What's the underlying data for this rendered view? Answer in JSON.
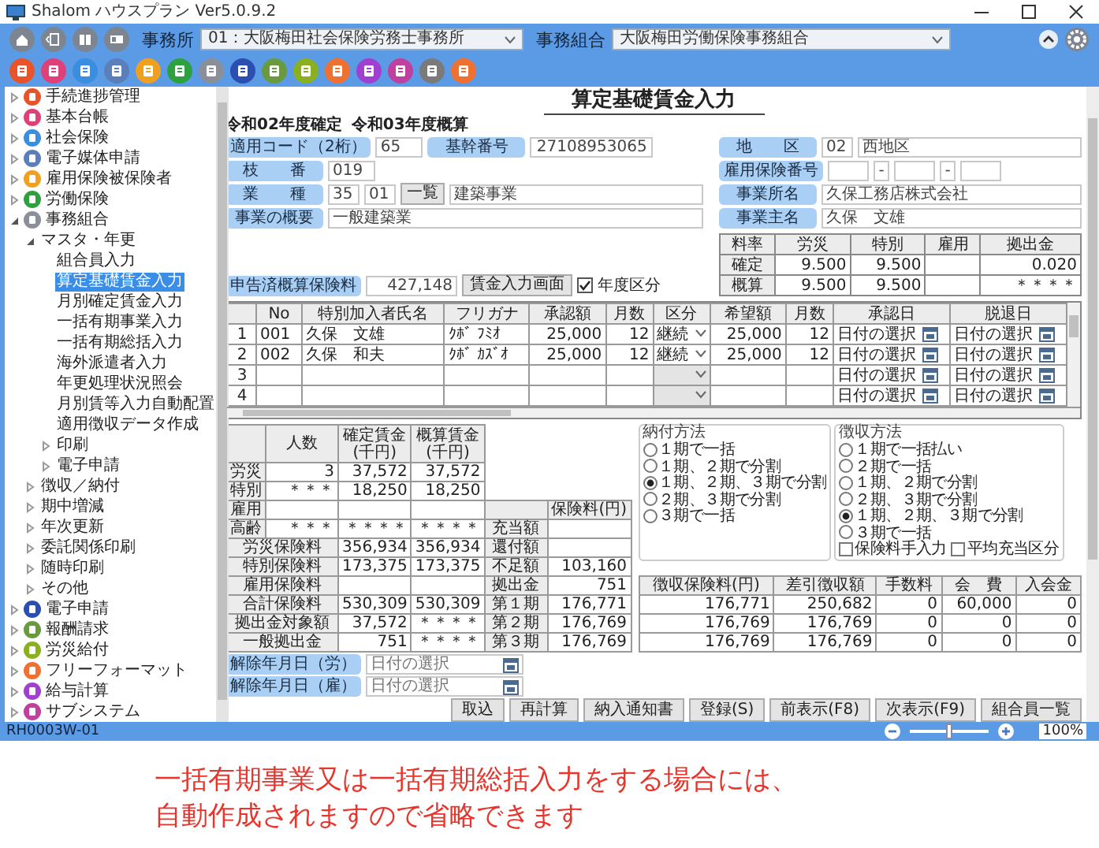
{
  "window": {
    "title": "Shalom ハウスプラン Ver5.0.9.2"
  },
  "toolbar": {
    "office_label": "事務所",
    "office": "01：大阪梅田社会保険労務士事務所",
    "union_label": "事務組合",
    "union": "大阪梅田労働保険事務組合",
    "apps": [
      {
        "color": "#e8542a"
      },
      {
        "color": "#e0407a"
      },
      {
        "color": "#3a8ee0"
      },
      {
        "color": "#5b7fb8"
      },
      {
        "color": "#f0a020"
      },
      {
        "color": "#2fa040"
      },
      {
        "color": "#8a8f99"
      },
      {
        "color": "#2b4fb0"
      },
      {
        "color": "#6a9a40"
      },
      {
        "color": "#8ab020"
      },
      {
        "color": "#f07030"
      },
      {
        "color": "#a040d0"
      },
      {
        "color": "#c040a0"
      },
      {
        "color": "#7a7a7a"
      },
      {
        "color": "#f07030"
      }
    ]
  },
  "sidebar": {
    "items": [
      {
        "label": "手続進捗管理",
        "color": "#e8542a",
        "expanded": false,
        "selected": false
      },
      {
        "label": "基本台帳",
        "color": "#e0407a",
        "expanded": false,
        "selected": false
      },
      {
        "label": "社会保険",
        "color": "#3a8ee0",
        "expanded": false,
        "selected": false
      },
      {
        "label": "電子媒体申請",
        "color": "#5b7fb8",
        "expanded": false,
        "selected": false
      },
      {
        "label": "雇用保険被保険者",
        "color": "#f0a020",
        "expanded": false,
        "selected": false
      },
      {
        "label": "労働保険",
        "color": "#2fa040",
        "expanded": false,
        "selected": false
      },
      {
        "label": "事務組合",
        "color": "#8a8f99",
        "expanded": true,
        "selected": false,
        "children": [
          {
            "label": "マスタ・年更",
            "expanded": true,
            "selected": false,
            "children": [
              {
                "label": "組合員入力",
                "selected": false
              },
              {
                "label": "算定基礎賃金入力",
                "selected": true
              },
              {
                "label": "月別確定賃金入力",
                "selected": false
              },
              {
                "label": "一括有期事業入力",
                "selected": false
              },
              {
                "label": "一括有期総括入力",
                "selected": false
              },
              {
                "label": "海外派遣者入力",
                "selected": false
              },
              {
                "label": "年更処理状況照会",
                "selected": false
              },
              {
                "label": "月別賃等入力自動配置",
                "selected": false
              },
              {
                "label": "適用徴収データ作成",
                "selected": false
              },
              {
                "label": "印刷",
                "expanded": false,
                "selected": false
              },
              {
                "label": "電子申請",
                "expanded": false,
                "selected": false
              }
            ]
          },
          {
            "label": "徴収／納付",
            "expanded": false,
            "selected": false
          },
          {
            "label": "期中増減",
            "expanded": false,
            "selected": false
          },
          {
            "label": "年次更新",
            "expanded": false,
            "selected": false
          },
          {
            "label": "委託関係印刷",
            "expanded": false,
            "selected": false
          },
          {
            "label": "随時印刷",
            "expanded": false,
            "selected": false
          },
          {
            "label": "その他",
            "expanded": false,
            "selected": false
          }
        ]
      },
      {
        "label": "電子申請",
        "color": "#2b4fb0",
        "expanded": false,
        "selected": false
      },
      {
        "label": "報酬請求",
        "color": "#6a9a40",
        "expanded": false,
        "selected": false
      },
      {
        "label": "労災給付",
        "color": "#8ab020",
        "expanded": false,
        "selected": false
      },
      {
        "label": "フリーフォーマット",
        "color": "#f07030",
        "expanded": false,
        "selected": false
      },
      {
        "label": "給与計算",
        "color": "#a040d0",
        "expanded": false,
        "selected": false
      },
      {
        "label": "サブシステム",
        "color": "#c040a0",
        "expanded": false,
        "selected": false
      }
    ]
  },
  "form": {
    "title": "算定基礎賃金入力",
    "period": [
      "令和02年度確定",
      "令和03年度概算"
    ],
    "left_rows": [
      [
        {
          "kind": "label",
          "text": "適用コード（2桁）"
        },
        {
          "kind": "code",
          "text": "65"
        },
        {
          "kind": "label",
          "text": "基幹番号"
        },
        {
          "kind": "field",
          "text": "27108953065"
        }
      ],
      [
        {
          "kind": "label",
          "text": "枝　　番"
        },
        {
          "kind": "code",
          "text": "019"
        }
      ],
      [
        {
          "kind": "label",
          "text": "業　　種"
        },
        {
          "kind": "tiny",
          "text": "35"
        },
        {
          "kind": "tiny",
          "text": "01"
        },
        {
          "kind": "button",
          "text": "一覧"
        },
        {
          "kind": "wide",
          "text": "建築事業"
        }
      ],
      [
        {
          "kind": "label",
          "text": "事業の概要"
        },
        {
          "kind": "wide",
          "text": "一般建築業"
        }
      ]
    ],
    "right_rows": [
      [
        {
          "kind": "label",
          "text": "地　　区"
        },
        {
          "kind": "tiny",
          "text": "02"
        },
        {
          "kind": "wide",
          "text": "西地区"
        }
      ],
      [
        {
          "kind": "label",
          "text": "雇用保険番号"
        },
        {
          "kind": "blank"
        },
        {
          "kind": "dash",
          "text": "-"
        },
        {
          "kind": "blank"
        },
        {
          "kind": "dash",
          "text": "-"
        },
        {
          "kind": "blank"
        }
      ],
      [
        {
          "kind": "label",
          "text": "事業所名"
        },
        {
          "kind": "wide",
          "text": "久保工務店株式会社"
        }
      ],
      [
        {
          "kind": "label",
          "text": "事業主名"
        },
        {
          "kind": "wide",
          "text": "久保　文雄"
        }
      ]
    ],
    "rates": {
      "columns": [
        "料率",
        "労災",
        "特別",
        "雇用",
        "拠出金"
      ],
      "rows": [
        [
          "確定",
          "9.500",
          "9.500",
          null,
          "0.020"
        ],
        [
          "概算",
          "9.500",
          "9.500",
          null,
          "＊＊＊＊"
        ]
      ]
    },
    "declared": {
      "label": "申告済概算保険料",
      "value": "427,148",
      "button": "賃金入力画面",
      "checkbox": {
        "label": "年度区分",
        "checked": true
      }
    }
  },
  "grid": {
    "columns": [
      {
        "kind": "index"
      },
      {
        "label": "No",
        "kind": "text"
      },
      {
        "label": "特別加入者氏名",
        "kind": "text"
      },
      {
        "label": "フリガナ",
        "kind": "text"
      },
      {
        "label": "承認額",
        "kind": "num"
      },
      {
        "label": "月数",
        "kind": "num"
      },
      {
        "label": "区分",
        "kind": "select"
      },
      {
        "label": "希望額",
        "kind": "num"
      },
      {
        "label": "月数",
        "kind": "num"
      },
      {
        "label": "承認日",
        "kind": "date"
      },
      {
        "label": "脱退日",
        "kind": "date"
      }
    ],
    "rows": [
      [
        "1",
        "001",
        "久保　文雄",
        "ｸﾎﾞ ﾌﾐｵ",
        "25,000",
        "12",
        "継続",
        "25,000",
        "12",
        "日付の選択",
        "日付の選択"
      ],
      [
        "2",
        "002",
        "久保　和夫",
        "ｸﾎﾞ ｶｽﾞｵ",
        "25,000",
        "12",
        "継続",
        "25,000",
        "12",
        "日付の選択",
        "日付の選択"
      ],
      [
        "3",
        null,
        null,
        null,
        null,
        null,
        null,
        null,
        null,
        "日付の選択",
        "日付の選択"
      ],
      [
        "4",
        null,
        null,
        null,
        null,
        null,
        null,
        null,
        null,
        "日付の選択",
        "日付の選択"
      ]
    ]
  },
  "summary": {
    "columns": [
      "人数",
      "確定賃金(千円)",
      "概算賃金(千円)"
    ],
    "rows": [
      {
        "label": "労災",
        "kind": "count",
        "count": "3",
        "fixed": "37,572",
        "estimated": "37,572"
      },
      {
        "label": "特別",
        "kind": "count",
        "count": "＊＊＊",
        "fixed": "18,250",
        "estimated": "18,250"
      },
      {
        "label": "雇用",
        "kind": "count"
      },
      {
        "label": "高齢",
        "kind": "count",
        "count": "＊＊＊",
        "fixed": "＊＊＊＊",
        "estimated": "＊＊＊＊"
      },
      {
        "label": "労災保険料",
        "kind": "total",
        "fixed": "356,934",
        "estimated": "356,934"
      },
      {
        "label": "特別保険料",
        "kind": "total",
        "fixed": "173,375",
        "estimated": "173,375"
      },
      {
        "label": "雇用保険料",
        "kind": "total"
      },
      {
        "label": "合計保険料",
        "kind": "total",
        "fixed": "530,309",
        "estimated": "530,309"
      },
      {
        "label": "拠出金対象額",
        "kind": "total",
        "fixed": "37,572",
        "estimated": "＊＊＊＊"
      },
      {
        "label": "一般拠出金",
        "kind": "total",
        "fixed": "751",
        "estimated": "＊＊＊＊"
      }
    ]
  },
  "premium": {
    "column": "保険料(円)",
    "rows": [
      {
        "label": "充当額"
      },
      {
        "label": "還付額"
      },
      {
        "label": "不足額",
        "value": "103,160"
      },
      {
        "label": "拠出金",
        "value": "751"
      },
      {
        "label": "第１期",
        "value": "176,771"
      },
      {
        "label": "第２期",
        "value": "176,769"
      },
      {
        "label": "第３期",
        "value": "176,769"
      }
    ]
  },
  "payment_method": {
    "title": "納付方法",
    "options": [
      {
        "label": "１期で一括",
        "selected": false
      },
      {
        "label": "１期、２期で分割",
        "selected": false
      },
      {
        "label": "１期、２期、３期で分割",
        "selected": true
      },
      {
        "label": "２期、３期で分割",
        "selected": false
      },
      {
        "label": "３期で一括",
        "selected": false
      }
    ]
  },
  "collection_method": {
    "title": "徴収方法",
    "options": [
      {
        "label": "１期で一括払い",
        "selected": false
      },
      {
        "label": "２期で一括",
        "selected": false
      },
      {
        "label": "１期、２期で分割",
        "selected": false
      },
      {
        "label": "２期、３期で分割",
        "selected": false
      },
      {
        "label": "１期、２期、３期で分割",
        "selected": true
      },
      {
        "label": "３期で一括",
        "selected": false
      }
    ],
    "checkboxes": [
      {
        "label": "保険料手入力",
        "checked": false
      },
      {
        "label": "平均充当区分",
        "checked": false
      }
    ]
  },
  "charges": {
    "columns": [
      "徴収保険料(円)",
      "差引徴収額",
      "手数料",
      "会　費",
      "入会金"
    ],
    "rows": [
      [
        "176,771",
        "250,682",
        "0",
        "60,000",
        "0"
      ],
      [
        "176,769",
        "176,769",
        "0",
        "0",
        "0"
      ],
      [
        "176,769",
        "176,769",
        "0",
        "0",
        "0"
      ]
    ]
  },
  "dates": [
    {
      "label": "解除年月日（労）",
      "placeholder": "日付の選択"
    },
    {
      "label": "解除年月日（雇）",
      "placeholder": "日付の選択"
    }
  ],
  "buttons": [
    "取込",
    "再計算",
    "納入通知書",
    "登録(S)",
    "前表示(F8)",
    "次表示(F9)",
    "組合員一覧"
  ],
  "status_bar": {
    "code": "RH0003W-01",
    "zoom_slider": {
      "level": 0.45
    },
    "zoom": "100%"
  },
  "caption": [
    "一括有期事業又は一括有期総括入力をする場合には、",
    "自動作成されますので省略できます"
  ]
}
